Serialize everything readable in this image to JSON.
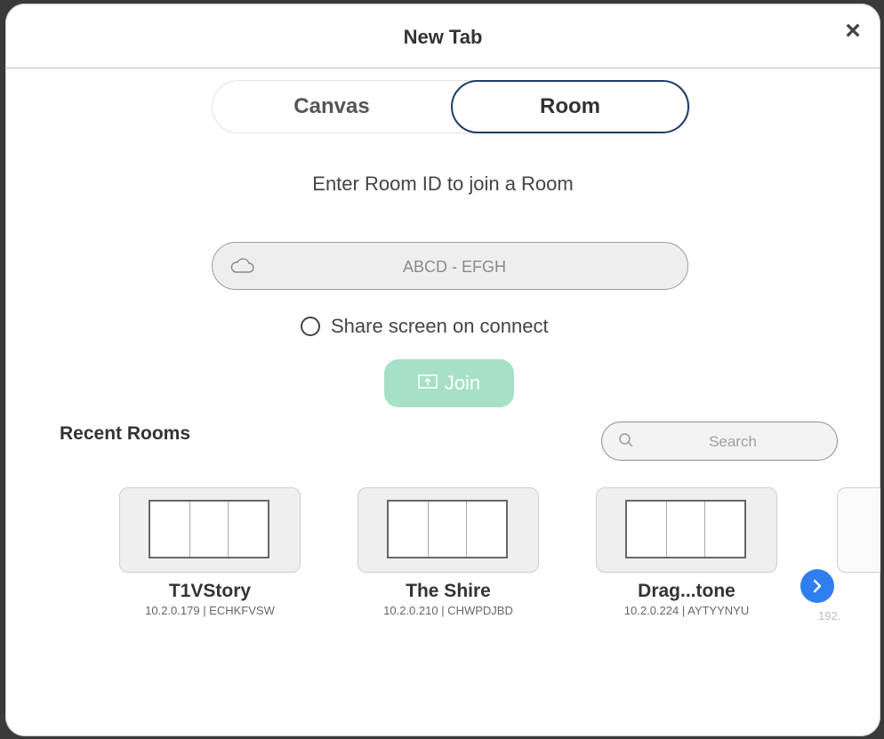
{
  "dialog": {
    "title": "New Tab",
    "close_glyph": "×"
  },
  "tabs": [
    {
      "label": "Canvas",
      "selected": false
    },
    {
      "label": "Room",
      "selected": true
    }
  ],
  "subtitle": "Enter Room ID to join a Room",
  "room_input": {
    "placeholder": "ABCD - EFGH",
    "value": "",
    "icon": "cloud-icon"
  },
  "share": {
    "label": "Share screen on connect",
    "checked": false
  },
  "join": {
    "label": "Join",
    "enabled": false,
    "icon": "share-screen-icon",
    "color": "#a6e0c6"
  },
  "recent": {
    "title": "Recent Rooms",
    "search_placeholder": "Search",
    "rooms": [
      {
        "name": "T1VStory",
        "meta": "10.2.0.179 | ECHKFVSW"
      },
      {
        "name": "The Shire",
        "meta": "10.2.0.210 | CHWPDJBD"
      },
      {
        "name": "Drag...tone",
        "meta": "10.2.0.224 | AYTYYNYU"
      }
    ],
    "partial_meta": "192.",
    "next_color": "#2f7ef0"
  },
  "colors": {
    "accent_border": "#1f3c66"
  }
}
